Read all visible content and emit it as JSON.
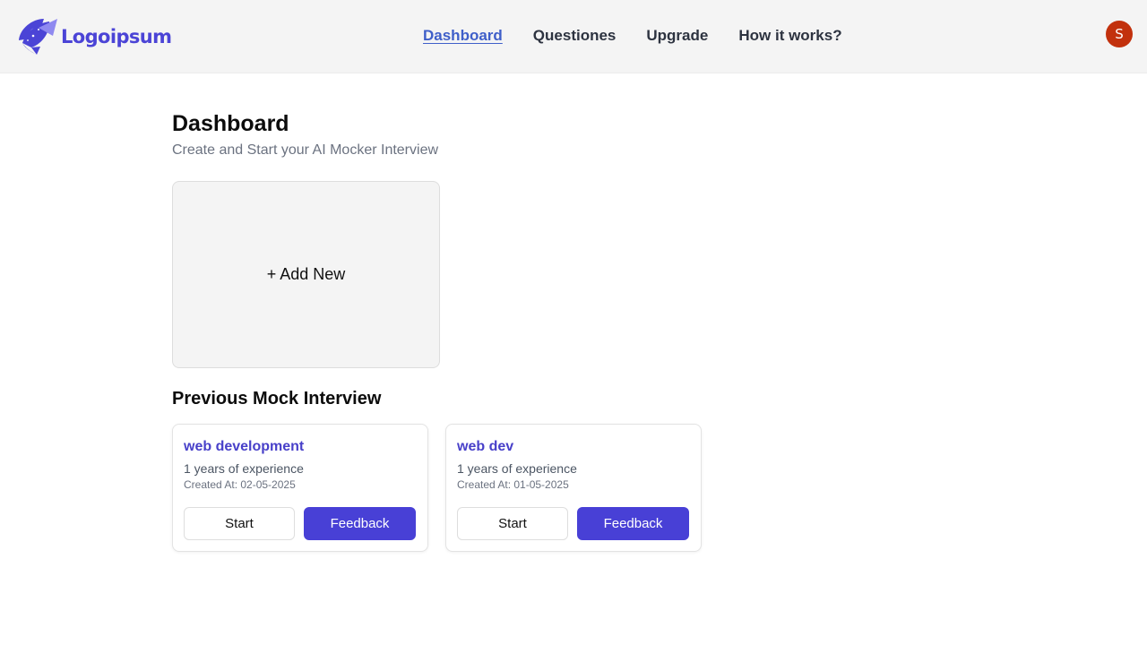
{
  "header": {
    "logo_text": "Logoipsum",
    "nav": [
      {
        "label": "Dashboard",
        "active": true
      },
      {
        "label": "Questiones",
        "active": false
      },
      {
        "label": "Upgrade",
        "active": false
      },
      {
        "label": "How it works?",
        "active": false
      }
    ],
    "avatar_initial": "S",
    "colors": {
      "brand": "#4b44d6",
      "avatar": "#c2310d",
      "active_nav": "#3f5fc9"
    }
  },
  "main": {
    "title": "Dashboard",
    "subtitle": "Create and Start your AI Mocker Interview",
    "add_new_label": "+ Add New",
    "previous_title": "Previous Mock Interview",
    "interviews": [
      {
        "role": "web development",
        "experience": "1 years of experience",
        "created_at": "Created At: 02-05-2025",
        "start_label": "Start",
        "feedback_label": "Feedback"
      },
      {
        "role": "web dev",
        "experience": "1 years of experience",
        "created_at": "Created At: 01-05-2025",
        "start_label": "Start",
        "feedback_label": "Feedback"
      }
    ]
  }
}
